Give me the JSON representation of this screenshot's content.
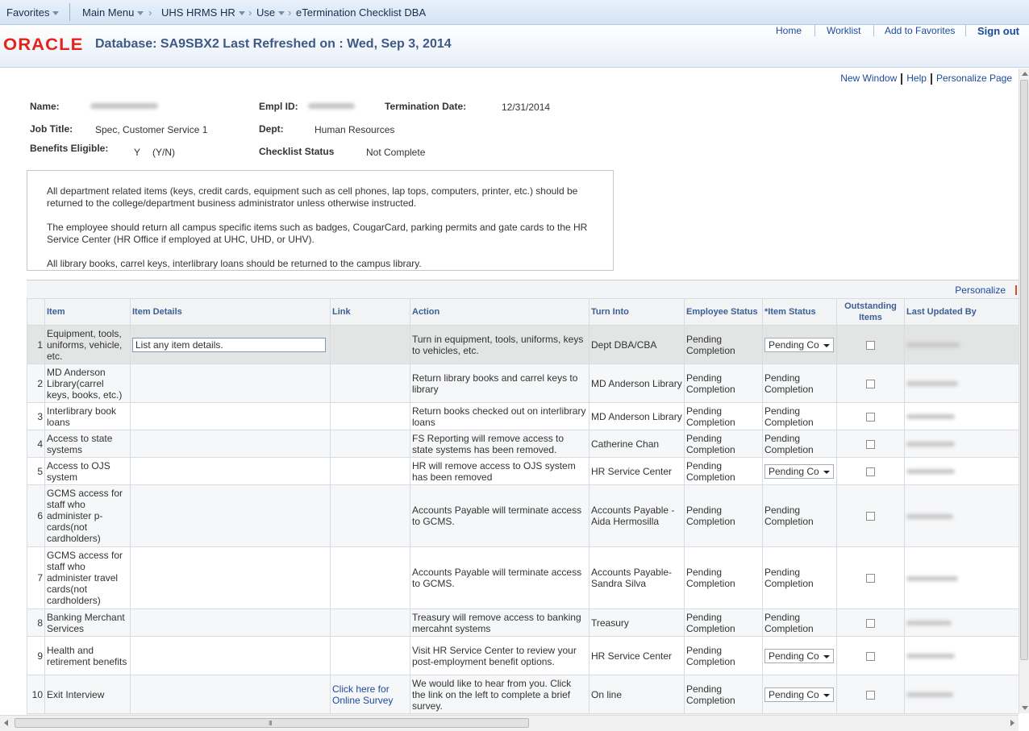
{
  "nav": {
    "favorites": "Favorites",
    "main_menu": "Main Menu",
    "crumb1": "UHS HRMS HR",
    "crumb2": "Use",
    "crumb3": "eTermination Checklist DBA"
  },
  "header": {
    "logo": "ORACLE",
    "db_title": "Database: SA9SBX2 Last Refreshed on : Wed, Sep 3, 2014",
    "links": {
      "home": "Home",
      "worklist": "Worklist",
      "add_favorites": "Add to Favorites",
      "sign_out": "Sign out"
    }
  },
  "page_links": {
    "new_window": "New Window",
    "help": "Help",
    "personalize_page": "Personalize Page"
  },
  "employee": {
    "name_label": "Name:",
    "emplid_label": "Empl ID:",
    "term_date_label": "Termination Date:",
    "term_date": "12/31/2014",
    "job_title_label": "Job Title:",
    "job_title": "Spec, Customer Service 1",
    "dept_label": "Dept:",
    "dept": "Human Resources",
    "benefits_label": "Benefits Eligible:",
    "benefits_value": "Y",
    "benefits_hint": "(Y/N)",
    "checklist_status_label": "Checklist Status",
    "checklist_status": "Not Complete"
  },
  "instructions": [
    "All department related items (keys, credit cards, equipment such as cell phones, lap tops, computers, printer, etc.) should be returned to the college/department business administrator unless otherwise instructed.",
    "The employee should return all campus specific items such as badges, CougarCard, parking permits and gate cards to the HR Service Center (HR Office if employed at UHC, UHD, or UHV).",
    "All library books, carrel keys, interlibrary loans should be returned to the campus library."
  ],
  "grid": {
    "personalize": "Personalize",
    "headers": {
      "item": "Item",
      "item_details": "Item Details",
      "link": "Link",
      "action": "Action",
      "turn_into": "Turn Into",
      "employee_status": "Employee Status",
      "item_status": "*Item Status",
      "outstanding": "Outstanding Items",
      "last_updated": "Last Updated By"
    },
    "rows": [
      {
        "num": "1",
        "item": "Equipment, tools, uniforms, vehicle, etc.",
        "details_placeholder": "List any item details.",
        "link": "",
        "action": "Turn in equipment, tools, uniforms, keys to vehicles, etc.",
        "turn_into": "Dept DBA/CBA",
        "emp_status": "Pending Completion",
        "item_status": "Pending Co",
        "editable": true
      },
      {
        "num": "2",
        "item": "MD Anderson Library(carrel keys, books, etc.)",
        "link": "",
        "action": "Return library books and carrel keys to library",
        "turn_into": "MD Anderson Library",
        "emp_status": "Pending Completion",
        "item_status": "Pending Completion",
        "editable": false
      },
      {
        "num": "3",
        "item": "Interlibrary book loans",
        "link": "",
        "action": "Return books checked out on interlibrary loans",
        "turn_into": "MD Anderson Library",
        "emp_status": "Pending Completion",
        "item_status": "Pending Completion",
        "editable": false
      },
      {
        "num": "4",
        "item": "Access to state systems",
        "link": "",
        "action": "FS Reporting will remove access to state systems has been removed.",
        "turn_into": "Catherine Chan",
        "emp_status": "Pending Completion",
        "item_status": "Pending Completion",
        "editable": false
      },
      {
        "num": "5",
        "item": "Access to OJS system",
        "link": "",
        "action": "HR will remove access to OJS system has been removed",
        "turn_into": "HR Service Center",
        "emp_status": "Pending Completion",
        "item_status": "Pending Co",
        "editable": true
      },
      {
        "num": "6",
        "item": "GCMS access for staff who administer p-cards(not cardholders)",
        "link": "",
        "action": "Accounts Payable will terminate access to GCMS.",
        "turn_into": "Accounts Payable -Aida Hermosilla",
        "emp_status": "Pending Completion",
        "item_status": "Pending Completion",
        "editable": false
      },
      {
        "num": "7",
        "item": "GCMS access for staff who administer travel cards(not cardholders)",
        "link": "",
        "action": "Accounts Payable will terminate access to GCMS.",
        "turn_into": "Accounts Payable- Sandra Silva",
        "emp_status": "Pending Completion",
        "item_status": "Pending Completion",
        "editable": false
      },
      {
        "num": "8",
        "item": "Banking Merchant Services",
        "link": "",
        "action": "Treasury will remove access to banking mercahnt systems",
        "turn_into": "Treasury",
        "emp_status": "Pending Completion",
        "item_status": "Pending Completion",
        "editable": false
      },
      {
        "num": "9",
        "item": "Health and retirement benefits",
        "link": "",
        "action": "Visit HR Service Center to review your post-employment benefit options.",
        "turn_into": "HR Service Center",
        "emp_status": "Pending Completion",
        "item_status": "Pending Co",
        "editable": true
      },
      {
        "num": "10",
        "item": "Exit Interview",
        "link": "Click here for Online Survey",
        "action": "We would like to hear from you. Click the link on the left to complete a brief survey.",
        "turn_into": "On line",
        "emp_status": "Pending Completion",
        "item_status": "Pending Co",
        "editable": true
      }
    ]
  }
}
